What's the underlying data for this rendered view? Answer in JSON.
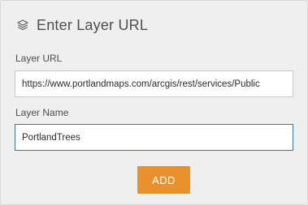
{
  "header": {
    "icon": "layers-icon",
    "title": "Enter Layer URL"
  },
  "form": {
    "url_label": "Layer URL",
    "url_value": "https://www.portlandmaps.com/arcgis/rest/services/Public",
    "name_label": "Layer Name",
    "name_value": "PortlandTrees"
  },
  "actions": {
    "add_label": "ADD",
    "add_color": "#e8912d"
  },
  "colors": {
    "panel_background": "#efefef",
    "focus_border": "#3a74c1"
  }
}
